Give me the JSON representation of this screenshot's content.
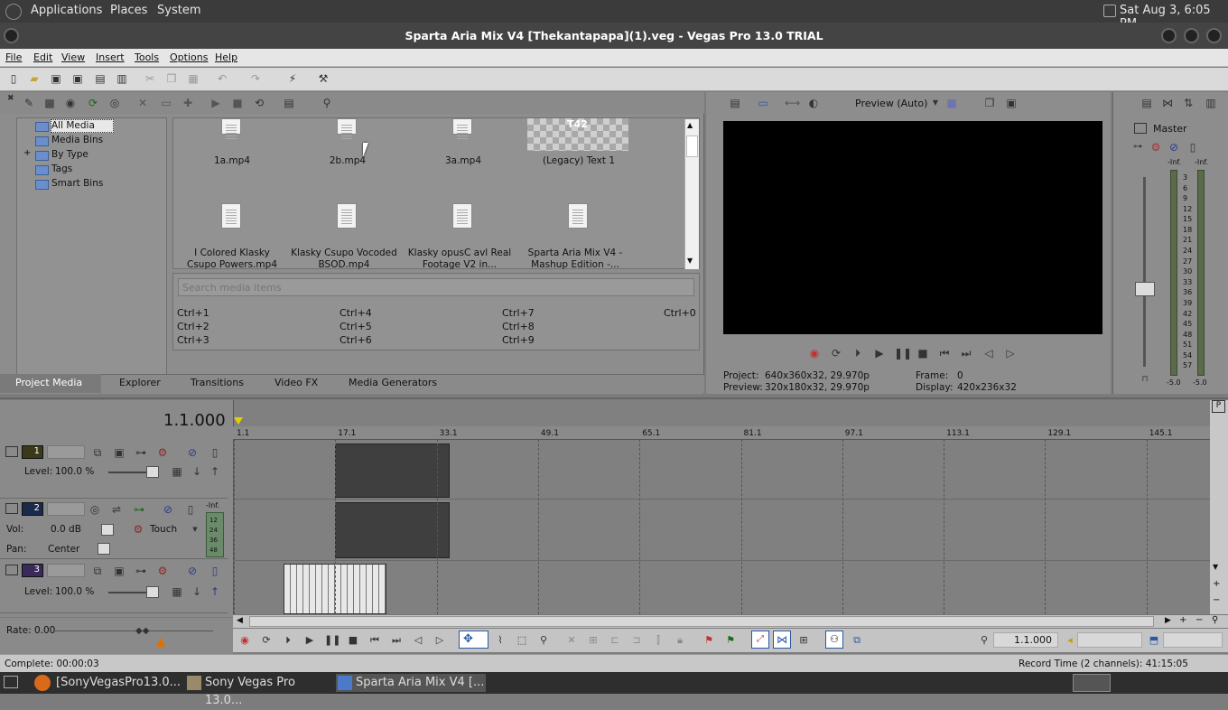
{
  "topbar": {
    "apps": "Applications",
    "places": "Places",
    "system": "System",
    "clock": "Sat Aug  3,  6:05 PM"
  },
  "window": {
    "title": "Sparta Aria Mix V4 [Thekantapapa](1).veg - Vegas Pro 13.0 TRIAL"
  },
  "menu": [
    "File",
    "Edit",
    "View",
    "Insert",
    "Tools",
    "Options",
    "Help"
  ],
  "tree": {
    "items": [
      "All Media",
      "Media Bins",
      "By Type",
      "Tags",
      "Smart Bins"
    ],
    "expander": "+"
  },
  "media": {
    "row1": [
      "1a.mp4",
      "2b.mp4",
      "3a.mp4",
      "(Legacy) Text 1"
    ],
    "text_thumb_label": "T42",
    "row2": [
      [
        "I Colored Klasky",
        "Csupo Powers.mp4"
      ],
      [
        "Klasky Csupo Vocoded",
        "BSOD.mp4"
      ],
      [
        "Klasky opusC avl Real",
        "Footage V2 in..."
      ],
      [
        "Sparta Aria Mix V4 -",
        "Mashup Edition -..."
      ]
    ]
  },
  "search": {
    "placeholder": "Search media items"
  },
  "shortcuts": [
    "Ctrl+1",
    "Ctrl+2",
    "Ctrl+3",
    "Ctrl+4",
    "Ctrl+5",
    "Ctrl+6",
    "Ctrl+7",
    "Ctrl+8",
    "Ctrl+9",
    "Ctrl+0"
  ],
  "tabs": [
    "Project Media",
    "Explorer",
    "Transitions",
    "Video FX",
    "Media Generators"
  ],
  "preview": {
    "mode": "Preview (Auto)",
    "project_label": "Project:",
    "project_value": "640x360x32, 29.970p",
    "preview_label": "Preview:",
    "preview_value": "320x180x32, 29.970p",
    "frame_label": "Frame:",
    "frame_value": "0",
    "display_label": "Display:",
    "display_value": "420x236x32"
  },
  "mixer": {
    "master": "Master",
    "inf_left": "-Inf.",
    "inf_right": "-Inf.",
    "scale": [
      "3",
      "6",
      "9",
      "12",
      "15",
      "18",
      "21",
      "24",
      "27",
      "30",
      "33",
      "36",
      "39",
      "42",
      "45",
      "48",
      "51",
      "54",
      "57"
    ],
    "bottom_left": "-5.0",
    "bottom_right": "-5.0"
  },
  "timeline": {
    "time": "1.1.000",
    "markers": [
      "1.1",
      "17.1",
      "33.1",
      "49.1",
      "65.1",
      "81.1",
      "97.1",
      "113.1",
      "129.1",
      "145.1"
    ],
    "tracks": [
      {
        "number": "1",
        "level_label": "Level:",
        "level_value": "100.0 %"
      },
      {
        "number": "2",
        "vol_label": "Vol:",
        "vol_value": "0.0 dB",
        "touch": "Touch",
        "pan_label": "Pan:",
        "pan_value": "Center",
        "meter_top": "-Inf.",
        "meter_marks": [
          "12",
          "24",
          "36",
          "48"
        ]
      },
      {
        "number": "3",
        "level_label": "Level:",
        "level_value": "100.0 %"
      }
    ],
    "rate": "Rate: 0.00",
    "cursor_time": "1.1.000"
  },
  "status": {
    "complete": "Complete: 00:00:03",
    "record": "Record Time (2 channels): 41:15:05"
  },
  "taskbar": [
    "[SonyVegasPro13.0...",
    "Sony Vegas Pro 13.0...",
    "Sparta Aria Mix V4 [..."
  ],
  "colors": {
    "accent_red": "#c23030",
    "selected_blue": "#2a58a8",
    "menu_bg": "#e6e6e6",
    "panel_bg": "#8d8d8d"
  }
}
